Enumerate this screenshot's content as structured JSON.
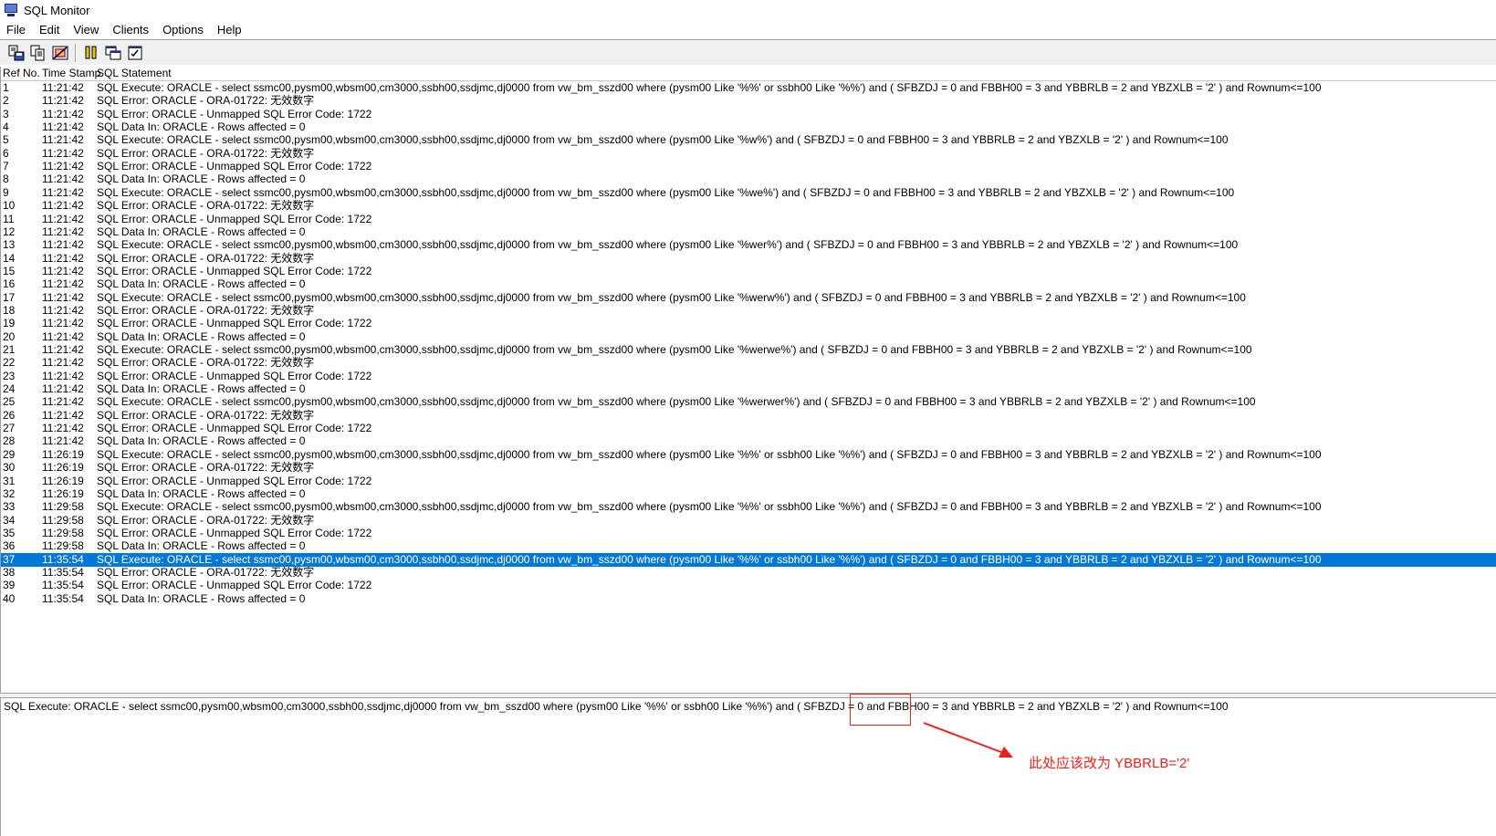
{
  "window": {
    "title": "SQL Monitor",
    "icon": "monitor-app-icon"
  },
  "menu": {
    "items": [
      "File",
      "Edit",
      "View",
      "Clients",
      "Options",
      "Help"
    ]
  },
  "toolbar": {
    "buttons": [
      {
        "icon": "save-log-icon"
      },
      {
        "icon": "copy-icon"
      },
      {
        "icon": "clear-icon"
      },
      {
        "icon": "pause-icon"
      },
      {
        "icon": "windows-icon"
      },
      {
        "icon": "checklist-icon"
      }
    ]
  },
  "grid": {
    "columns": {
      "ref": "Ref No.",
      "time": "Time Stamp",
      "sql": "SQL Statement"
    },
    "selected_ref": "37",
    "rows": [
      {
        "ref": "1",
        "time": "11:21:42",
        "sql": "SQL Execute: ORACLE - select ssmc00,pysm00,wbsm00,cm3000,ssbh00,ssdjmc,dj0000 from vw_bm_sszd00 where (pysm00 Like '%%' or ssbh00 Like '%%') and (  SFBZDJ = 0 and FBBH00 = 3 and YBBRLB = 2 and YBZXLB = '2' )  and Rownum<=100"
      },
      {
        "ref": "2",
        "time": "11:21:42",
        "sql": "SQL Error: ORACLE - ORA-01722: 无效数字"
      },
      {
        "ref": "3",
        "time": "11:21:42",
        "sql": "SQL Error: ORACLE - Unmapped SQL Error Code: 1722"
      },
      {
        "ref": "4",
        "time": "11:21:42",
        "sql": "SQL Data In: ORACLE - Rows affected = 0"
      },
      {
        "ref": "5",
        "time": "11:21:42",
        "sql": "SQL Execute: ORACLE - select ssmc00,pysm00,wbsm00,cm3000,ssbh00,ssdjmc,dj0000 from vw_bm_sszd00 where (pysm00 Like '%w%') and (  SFBZDJ = 0 and FBBH00 = 3 and YBBRLB = 2 and YBZXLB = '2' )  and Rownum<=100"
      },
      {
        "ref": "6",
        "time": "11:21:42",
        "sql": "SQL Error: ORACLE - ORA-01722: 无效数字"
      },
      {
        "ref": "7",
        "time": "11:21:42",
        "sql": "SQL Error: ORACLE - Unmapped SQL Error Code: 1722"
      },
      {
        "ref": "8",
        "time": "11:21:42",
        "sql": "SQL Data In: ORACLE - Rows affected = 0"
      },
      {
        "ref": "9",
        "time": "11:21:42",
        "sql": "SQL Execute: ORACLE - select ssmc00,pysm00,wbsm00,cm3000,ssbh00,ssdjmc,dj0000 from vw_bm_sszd00 where (pysm00 Like '%we%') and (  SFBZDJ = 0 and FBBH00 = 3 and YBBRLB = 2 and YBZXLB = '2' )  and Rownum<=100"
      },
      {
        "ref": "10",
        "time": "11:21:42",
        "sql": "SQL Error: ORACLE - ORA-01722: 无效数字"
      },
      {
        "ref": "11",
        "time": "11:21:42",
        "sql": "SQL Error: ORACLE - Unmapped SQL Error Code: 1722"
      },
      {
        "ref": "12",
        "time": "11:21:42",
        "sql": "SQL Data In: ORACLE - Rows affected = 0"
      },
      {
        "ref": "13",
        "time": "11:21:42",
        "sql": "SQL Execute: ORACLE - select ssmc00,pysm00,wbsm00,cm3000,ssbh00,ssdjmc,dj0000 from vw_bm_sszd00 where (pysm00 Like '%wer%') and (  SFBZDJ = 0 and FBBH00 = 3 and YBBRLB = 2 and YBZXLB = '2' )  and Rownum<=100"
      },
      {
        "ref": "14",
        "time": "11:21:42",
        "sql": "SQL Error: ORACLE - ORA-01722: 无效数字"
      },
      {
        "ref": "15",
        "time": "11:21:42",
        "sql": "SQL Error: ORACLE - Unmapped SQL Error Code: 1722"
      },
      {
        "ref": "16",
        "time": "11:21:42",
        "sql": "SQL Data In: ORACLE - Rows affected = 0"
      },
      {
        "ref": "17",
        "time": "11:21:42",
        "sql": "SQL Execute: ORACLE - select ssmc00,pysm00,wbsm00,cm3000,ssbh00,ssdjmc,dj0000 from vw_bm_sszd00 where (pysm00 Like '%werw%') and (  SFBZDJ = 0 and FBBH00 = 3 and YBBRLB = 2 and YBZXLB = '2' )  and Rownum<=100"
      },
      {
        "ref": "18",
        "time": "11:21:42",
        "sql": "SQL Error: ORACLE - ORA-01722: 无效数字"
      },
      {
        "ref": "19",
        "time": "11:21:42",
        "sql": "SQL Error: ORACLE - Unmapped SQL Error Code: 1722"
      },
      {
        "ref": "20",
        "time": "11:21:42",
        "sql": "SQL Data In: ORACLE - Rows affected = 0"
      },
      {
        "ref": "21",
        "time": "11:21:42",
        "sql": "SQL Execute: ORACLE - select ssmc00,pysm00,wbsm00,cm3000,ssbh00,ssdjmc,dj0000 from vw_bm_sszd00 where (pysm00 Like '%werwe%') and (  SFBZDJ = 0 and FBBH00 = 3 and YBBRLB = 2 and YBZXLB = '2' )  and Rownum<=100"
      },
      {
        "ref": "22",
        "time": "11:21:42",
        "sql": "SQL Error: ORACLE - ORA-01722: 无效数字"
      },
      {
        "ref": "23",
        "time": "11:21:42",
        "sql": "SQL Error: ORACLE - Unmapped SQL Error Code: 1722"
      },
      {
        "ref": "24",
        "time": "11:21:42",
        "sql": "SQL Data In: ORACLE - Rows affected = 0"
      },
      {
        "ref": "25",
        "time": "11:21:42",
        "sql": "SQL Execute: ORACLE - select ssmc00,pysm00,wbsm00,cm3000,ssbh00,ssdjmc,dj0000 from vw_bm_sszd00 where (pysm00 Like '%werwer%') and (  SFBZDJ = 0 and FBBH00 = 3 and YBBRLB = 2 and YBZXLB = '2' )  and Rownum<=100"
      },
      {
        "ref": "26",
        "time": "11:21:42",
        "sql": "SQL Error: ORACLE - ORA-01722: 无效数字"
      },
      {
        "ref": "27",
        "time": "11:21:42",
        "sql": "SQL Error: ORACLE - Unmapped SQL Error Code: 1722"
      },
      {
        "ref": "28",
        "time": "11:21:42",
        "sql": "SQL Data In: ORACLE - Rows affected = 0"
      },
      {
        "ref": "29",
        "time": "11:26:19",
        "sql": "SQL Execute: ORACLE - select ssmc00,pysm00,wbsm00,cm3000,ssbh00,ssdjmc,dj0000 from vw_bm_sszd00 where (pysm00 Like '%%' or ssbh00 Like '%%') and (  SFBZDJ = 0 and FBBH00 = 3 and YBBRLB = 2 and YBZXLB = '2' )  and Rownum<=100"
      },
      {
        "ref": "30",
        "time": "11:26:19",
        "sql": "SQL Error: ORACLE - ORA-01722: 无效数字"
      },
      {
        "ref": "31",
        "time": "11:26:19",
        "sql": "SQL Error: ORACLE - Unmapped SQL Error Code: 1722"
      },
      {
        "ref": "32",
        "time": "11:26:19",
        "sql": "SQL Data In: ORACLE - Rows affected = 0"
      },
      {
        "ref": "33",
        "time": "11:29:58",
        "sql": "SQL Execute: ORACLE - select ssmc00,pysm00,wbsm00,cm3000,ssbh00,ssdjmc,dj0000 from vw_bm_sszd00 where (pysm00 Like '%%' or ssbh00 Like '%%') and (  SFBZDJ = 0 and FBBH00 = 3 and YBBRLB = 2 and YBZXLB = '2' )  and Rownum<=100"
      },
      {
        "ref": "34",
        "time": "11:29:58",
        "sql": "SQL Error: ORACLE - ORA-01722: 无效数字"
      },
      {
        "ref": "35",
        "time": "11:29:58",
        "sql": "SQL Error: ORACLE - Unmapped SQL Error Code: 1722"
      },
      {
        "ref": "36",
        "time": "11:29:58",
        "sql": "SQL Data In: ORACLE - Rows affected = 0"
      },
      {
        "ref": "37",
        "time": "11:35:54",
        "sql": "SQL Execute: ORACLE - select ssmc00,pysm00,wbsm00,cm3000,ssbh00,ssdjmc,dj0000 from vw_bm_sszd00 where (pysm00 Like '%%' or ssbh00 Like '%%') and (  SFBZDJ = 0 and FBBH00 = 3 and YBBRLB = 2 and YBZXLB = '2' )  and Rownum<=100"
      },
      {
        "ref": "38",
        "time": "11:35:54",
        "sql": "SQL Error: ORACLE - ORA-01722: 无效数字"
      },
      {
        "ref": "39",
        "time": "11:35:54",
        "sql": "SQL Error: ORACLE - Unmapped SQL Error Code: 1722"
      },
      {
        "ref": "40",
        "time": "11:35:54",
        "sql": "SQL Data In: ORACLE - Rows affected = 0"
      }
    ]
  },
  "detail": {
    "text": "SQL Execute: ORACLE - select ssmc00,pysm00,wbsm00,cm3000,ssbh00,ssdjmc,dj0000 from vw_bm_sszd00 where (pysm00 Like '%%' or ssbh00 Like '%%') and (  SFBZDJ = 0 and FBBH00 = 3 and YBBRLB = 2 and YBZXLB = '2' )  and Rownum<=100"
  },
  "annotation": {
    "text": "此处应该改为  YBBRLB='2'",
    "color": "#e8231a"
  },
  "colors": {
    "selection": "#0078d7",
    "toolbar_bg": "#f0f0f0"
  }
}
